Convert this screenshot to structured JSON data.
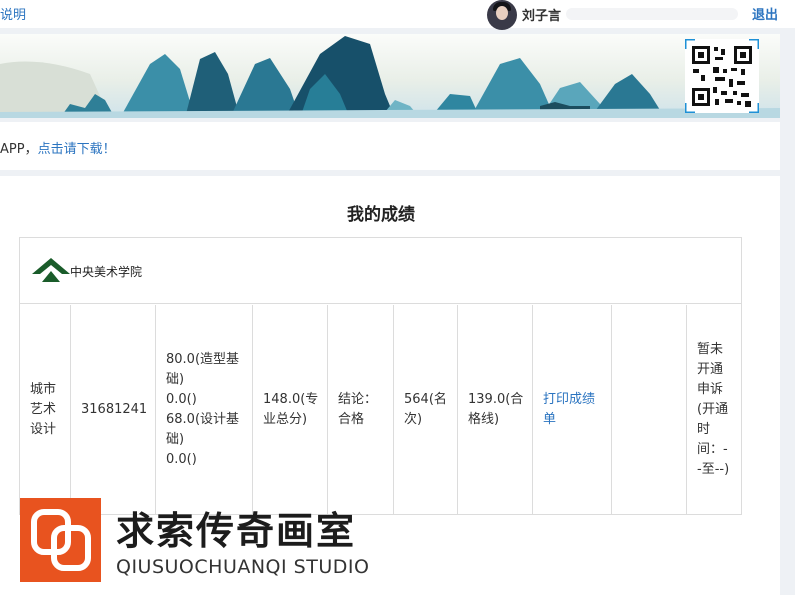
{
  "header": {
    "top_link": "说明",
    "user_name": "刘子言",
    "logout": "退出"
  },
  "app_notice": {
    "text": "APP，",
    "link": "点击请下载！"
  },
  "main": {
    "title": "我的成绩",
    "school_name": "中央美术学院",
    "row": {
      "major": "城市艺术设计",
      "exam_id": "31681241",
      "subject_scores": [
        "80.0(造型基础)",
        "0.0()",
        "68.0(设计基础)",
        "0.0()"
      ],
      "total": "148.0(专业总分)",
      "conclusion": "结论：合格",
      "rank": "564(名次)",
      "passing_line": "139.0(合格线)",
      "print_link": "打印成绩单",
      "blank": "",
      "appeal": "暂未开通申诉(开通时间：--至--)"
    }
  },
  "watermark": {
    "cn": "求索传奇画室",
    "en": "QIUSUOCHUANQI STUDIO"
  },
  "colors": {
    "link": "#2b74c0",
    "border": "#dcdcdc",
    "watermark_logo": "#e8531f",
    "school_logo": "#1a5c2a"
  }
}
